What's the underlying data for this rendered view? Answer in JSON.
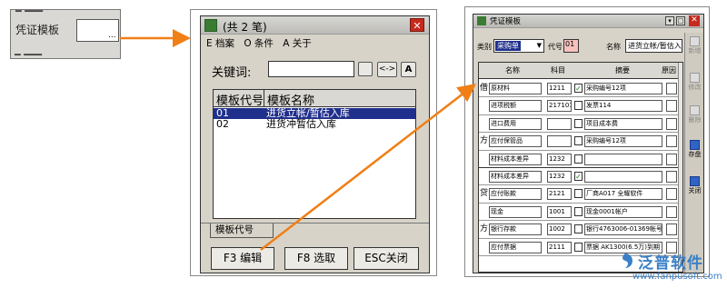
{
  "snippet": {
    "label": "凭证模板",
    "browse": "..."
  },
  "dialog1": {
    "title": "(共 2 笔)",
    "menu": [
      "E 档案",
      "O 条件",
      "A 关于"
    ],
    "keyword_label": "关键词:",
    "keyword_value": "",
    "btn_swap": "<->",
    "btn_a": "A",
    "table": {
      "headers": [
        "模板代号",
        "模板名称"
      ],
      "rows": [
        {
          "code": "01",
          "name": "进货立帐/暂估入库"
        },
        {
          "code": "02",
          "name": "进货冲暂估入库"
        }
      ]
    },
    "tab": "模板代号",
    "buttons": [
      "F3 编辑",
      "F8 选取",
      "ESC关闭"
    ]
  },
  "dialog2": {
    "title": "凭证模板",
    "type_label": "类别",
    "type_value": "采购单",
    "code_label": "代号",
    "code_value": "01",
    "name_label": "名称",
    "name_value": "进货立帐/暂估入库",
    "headers": [
      "名称",
      "科目",
      "摘要",
      "原因"
    ],
    "rows": [
      {
        "dir": "借",
        "name": "原材料",
        "subject": "1211",
        "checked": true,
        "summary": "采购编号12项"
      },
      {
        "dir": "",
        "name": "进项税额",
        "subject": "21710101",
        "checked": false,
        "summary": "发票114"
      },
      {
        "dir": "",
        "name": "进口费用",
        "subject": "",
        "checked": false,
        "summary": "项目成本费"
      },
      {
        "dir": "方",
        "name": "应付保管品",
        "subject": "",
        "checked": false,
        "summary": "采购编号12项"
      },
      {
        "dir": "",
        "name": "材料成本差异",
        "subject": "1232",
        "checked": false,
        "summary": ""
      },
      {
        "dir": "",
        "name": "材料成本差异",
        "subject": "1232",
        "checked": true,
        "summary": ""
      },
      {
        "dir": "贷",
        "name": "应付账款",
        "subject": "2121",
        "checked": false,
        "summary": "厂商A017 全耀软件"
      },
      {
        "dir": "",
        "name": "现金",
        "subject": "1001",
        "checked": false,
        "summary": "现金0001帐户"
      },
      {
        "dir": "方",
        "name": "银行存款",
        "subject": "1002",
        "checked": false,
        "summary": "银行4763006-01369帐号"
      },
      {
        "dir": "",
        "name": "应付票据",
        "subject": "2111",
        "checked": false,
        "summary": "票据 AK1300(6.5万)到期"
      }
    ],
    "side_buttons": [
      {
        "label": "新增",
        "enabled": false
      },
      {
        "label": "修改",
        "enabled": false
      },
      {
        "label": "删除",
        "enabled": false
      },
      {
        "label": "存盘",
        "enabled": true
      },
      {
        "label": "关闭",
        "enabled": true
      }
    ]
  },
  "watermark": {
    "text": "泛普软件",
    "url": "www.fanpusoft.com"
  },
  "colors": {
    "arrow": "#f07f16",
    "selection": "#1f2f8c",
    "close": "#c52a1c"
  }
}
